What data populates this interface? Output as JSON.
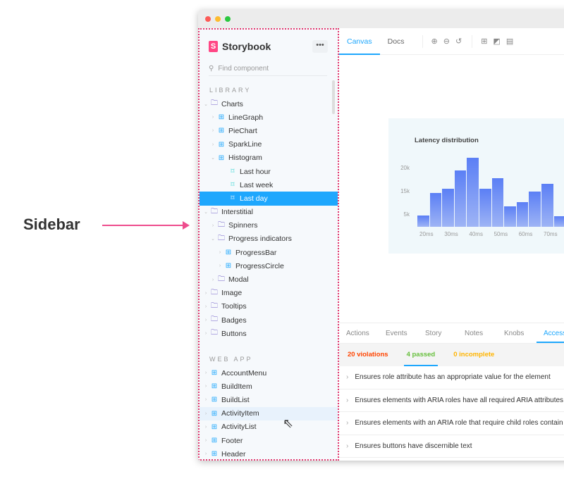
{
  "callout": {
    "label": "Sidebar"
  },
  "colors": {
    "accent": "#1ea7fd",
    "brand": "#ff4785",
    "violations": "#ff4400",
    "passed": "#66bf3c",
    "incomplete": "#ffb400",
    "outline": "#e2386e"
  },
  "sidebar": {
    "brand": "Storybook",
    "logo_letter": "S",
    "more_label": "•••",
    "search_placeholder": "Find component",
    "library_label": "LIBRARY",
    "library_items": [
      {
        "label": "Charts",
        "type": "folder",
        "depth": 0
      },
      {
        "label": "LineGraph",
        "type": "component",
        "depth": 1
      },
      {
        "label": "PieChart",
        "type": "component",
        "depth": 1
      },
      {
        "label": "SparkLine",
        "type": "component",
        "depth": 1
      },
      {
        "label": "Histogram",
        "type": "component",
        "depth": 1,
        "expanded": true
      },
      {
        "label": "Last hour",
        "type": "story",
        "depth": 2
      },
      {
        "label": "Last week",
        "type": "story",
        "depth": 2
      },
      {
        "label": "Last day",
        "type": "story",
        "depth": 2,
        "selected": true
      },
      {
        "label": "Interstitial",
        "type": "folder",
        "depth": 0
      },
      {
        "label": "Spinners",
        "type": "folder",
        "depth": 1
      },
      {
        "label": "Progress indicators",
        "type": "folder",
        "depth": 1
      },
      {
        "label": "ProgressBar",
        "type": "component",
        "depth": 2
      },
      {
        "label": "ProgressCircle",
        "type": "component",
        "depth": 2
      },
      {
        "label": "Modal",
        "type": "folder",
        "depth": 1
      },
      {
        "label": "Image",
        "type": "folder",
        "depth": 0
      },
      {
        "label": "Tooltips",
        "type": "folder",
        "depth": 0
      },
      {
        "label": "Badges",
        "type": "folder",
        "depth": 0
      },
      {
        "label": "Buttons",
        "type": "folder",
        "depth": 0
      }
    ],
    "webapp_label": "WEB APP",
    "webapp_items": [
      {
        "label": "AccountMenu",
        "type": "component",
        "depth": 0
      },
      {
        "label": "BuildItem",
        "type": "component",
        "depth": 0
      },
      {
        "label": "BuildList",
        "type": "component",
        "depth": 0
      },
      {
        "label": "ActivityItem",
        "type": "component",
        "depth": 0,
        "hovered": true
      },
      {
        "label": "ActivityList",
        "type": "component",
        "depth": 0
      },
      {
        "label": "Footer",
        "type": "component",
        "depth": 0
      },
      {
        "label": "Header",
        "type": "component",
        "depth": 0
      }
    ]
  },
  "toolbar": {
    "tabs": [
      "Canvas",
      "Docs"
    ],
    "active_tab": "Canvas",
    "icons": [
      "zoom-in-icon",
      "zoom-out-icon",
      "zoom-reset-icon",
      "grid-icon",
      "background-icon",
      "viewport-icon"
    ]
  },
  "chart_data": {
    "type": "bar",
    "title": "Latency distribution",
    "y_tick_labels": [
      "20k",
      "15k",
      "5k"
    ],
    "x_tick_labels": [
      "20ms",
      "30ms",
      "40ms",
      "50ms",
      "60ms",
      "70ms"
    ],
    "values": [
      3.8,
      11.4,
      12.8,
      19,
      23.3,
      12.8,
      16.4,
      6.9,
      8.3,
      11.9,
      14.5,
      3.6
    ],
    "value_unit": "k",
    "grid": false
  },
  "addons": {
    "tabs": [
      "Actions",
      "Events",
      "Story",
      "Notes",
      "Knobs",
      "Accessibility"
    ],
    "active_tab": "Accessibility",
    "subtabs": [
      {
        "label": "20 violations",
        "color": "#ff4400"
      },
      {
        "label": "4 passed",
        "color": "#66bf3c"
      },
      {
        "label": "0 incomplete",
        "color": "#ffb400"
      }
    ],
    "active_subtab": "4 passed",
    "rules": [
      "Ensures role attribute has an appropriate value for the element",
      "Ensures elements with ARIA roles have all required ARIA attributes",
      "Ensures elements with an ARIA role that require child roles contain them",
      "Ensures buttons have discernible text"
    ]
  }
}
